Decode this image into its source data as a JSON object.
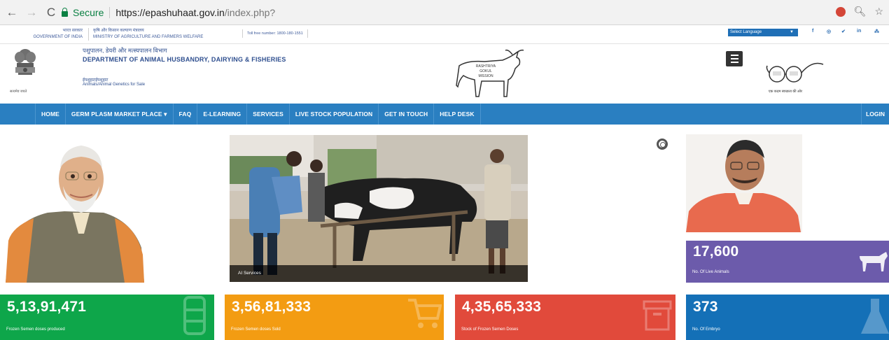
{
  "browser": {
    "secure_label": "Secure",
    "url_host": "https://epashuhaat.gov.in",
    "url_path": "/index.php?"
  },
  "gov_strip": {
    "gov_hi": "भारत सरकार",
    "gov_en": "GOVERNMENT OF INDIA",
    "ministry_hi": "कृषि और किसान कल्याण मंत्रालय",
    "ministry_en": "MINISTRY OF AGRICULTURE AND FARMERS WELFARE",
    "toll_free": "Toll free number: 1800-180-1551",
    "language": "Select Language",
    "social": [
      "f",
      "◎",
      "✔",
      "in",
      "⁂"
    ]
  },
  "header": {
    "emblem_caption": "सत्यमेव जयते",
    "dept_hi": "पशुपालन, डेयरी और मत्स्यपालन विभाग",
    "dept_en": "DEPARTMENT OF ANIMAL HUSBANDRY, DAIRYING & FISHERIES",
    "site_hi": "ईपशुहाटईपशुहाट",
    "site_en": "Animals/Animal Genetics for Sale",
    "logo_text": [
      "RASHTRIYA",
      "GOKUL",
      "MISSION"
    ],
    "swachh_caption": "एक कदम स्वच्छता की ओर"
  },
  "menu": {
    "items": [
      "HOME",
      "GERM PLASM MARKET PLACE ▾",
      "FAQ",
      "E-LEARNING",
      "SERVICES",
      "LIVE STOCK POPULATION",
      "GET IN TOUCH",
      "HELP DESK"
    ],
    "login": "LOGIN"
  },
  "slider": {
    "caption": "AI Services"
  },
  "stats": {
    "live_animals": {
      "value": "17,600",
      "label": "No. Of Live Animals",
      "color": "#6c5bab"
    },
    "semen_produced": {
      "value": "5,13,91,471",
      "label": "Frozen Semen doses produced",
      "color": "#0ea64a"
    },
    "semen_sold": {
      "value": "3,56,81,333",
      "label": "Frozen Semen doses Sold",
      "color": "#f39c12"
    },
    "semen_stock": {
      "value": "4,35,65,333",
      "label": "Stock of Frozen Semen Doses",
      "color": "#e14a3b"
    },
    "embryo": {
      "value": "373",
      "label": "No. Of Embryo",
      "color": "#1470b7"
    }
  }
}
